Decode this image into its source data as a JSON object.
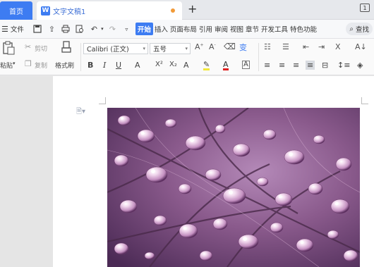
{
  "tabs": {
    "home": "首页",
    "document": "文字文稿1",
    "doc_icon_letter": "W"
  },
  "menu": {
    "file": "文件",
    "ribbon_tabs": [
      "开始",
      "插入",
      "页面布局",
      "引用",
      "审阅",
      "视图",
      "章节",
      "开发工具",
      "特色功能"
    ],
    "active_tab": "开始",
    "search": "查找"
  },
  "ribbon": {
    "paste": "粘贴",
    "cut": "剪切",
    "copy": "复制",
    "format_painter": "格式刷",
    "font_name": "Calibri (正文)",
    "font_size": "五号"
  },
  "colors": {
    "accent": "#3d7cf2",
    "unsaved": "#f19a38"
  },
  "icons": [
    "menu-icon",
    "save-icon",
    "export-icon",
    "print-icon",
    "preview-icon",
    "undo-icon",
    "redo-icon",
    "paste-icon",
    "cut-icon",
    "copy-icon",
    "brush-icon",
    "search-icon",
    "paragraph-icon"
  ]
}
